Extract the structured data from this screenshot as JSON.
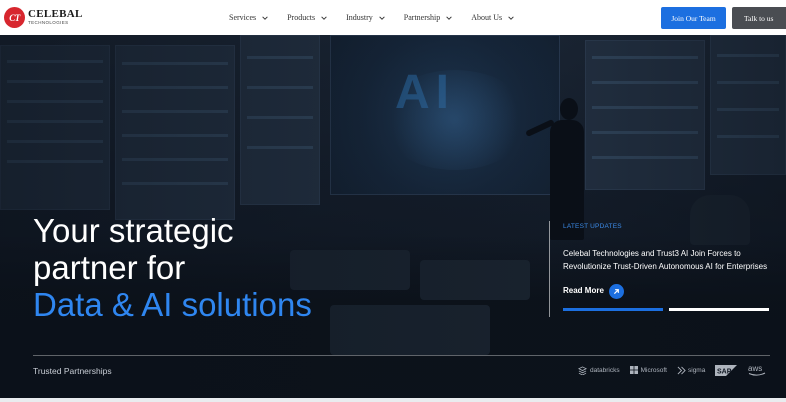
{
  "header": {
    "logo": {
      "mark": "CT",
      "name": "CELEBAL",
      "sub": "TECHNOLOGIES"
    },
    "nav": [
      {
        "label": "Services"
      },
      {
        "label": "Products"
      },
      {
        "label": "Industry"
      },
      {
        "label": "Partnership"
      },
      {
        "label": "About Us"
      }
    ],
    "join_button": "Join Our Team",
    "talk_button": "Talk to us"
  },
  "hero": {
    "headline_line1": "Your strategic",
    "headline_line2": "partner for",
    "headline_line3": "Data & AI solutions",
    "accent_color": "#2f86f0",
    "background_text": "AI"
  },
  "updates": {
    "label": "LATEST UPDATES",
    "title": "Celebal Technologies and Trust3 AI Join Forces to Revolutionize Trust-Driven Autonomous AI for Enterprises",
    "read_more": "Read More",
    "read_more_icon": "arrow-up-right-icon"
  },
  "partners": {
    "label": "Trusted Partnerships",
    "logos": [
      {
        "name": "databricks",
        "icon": "databricks-icon"
      },
      {
        "name": "Microsoft",
        "icon": "microsoft-icon"
      },
      {
        "name": "sigma",
        "icon": "sigma-icon"
      },
      {
        "name": "SAP",
        "icon": "sap-icon"
      },
      {
        "name": "aws",
        "icon": "aws-icon"
      }
    ]
  },
  "colors": {
    "primary": "#1c6fe0",
    "dark_button": "#4a4d52",
    "logo_red": "#d7262e"
  }
}
